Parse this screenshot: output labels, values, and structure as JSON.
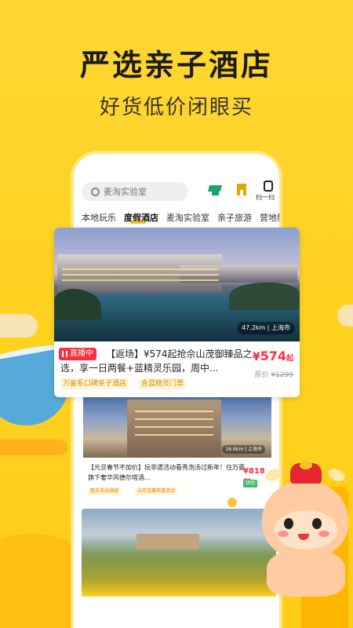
{
  "promo": {
    "headline": "严选亲子酒店",
    "subline": "好货低价闭眼买"
  },
  "app": {
    "search": {
      "placeholder": "麦淘实验室",
      "icon": "search-icon"
    },
    "top_icons": [
      {
        "icon": "graduation-cap-icon",
        "color": "#1DA36B"
      },
      {
        "icon": "building-icon",
        "color": "#E0A800"
      },
      {
        "icon": "scan-icon",
        "label": "扫一扫"
      }
    ],
    "tabs": [
      {
        "label": "本地玩乐"
      },
      {
        "label": "度假酒店",
        "active": true
      },
      {
        "label": "麦淘实验室"
      },
      {
        "label": "亲子旅游"
      },
      {
        "label": "营地教"
      }
    ]
  },
  "featured_card": {
    "distance": "47.2km | 上海市",
    "live_badge": "直播中",
    "title": "【返场】¥574起抢佘山茂御臻品之选，享一日两餐+蓝精灵乐园，周中...",
    "price_prefix": "¥",
    "price": "574",
    "price_suffix": "起",
    "original_label": "原价",
    "original_price": "¥1299",
    "tags": [
      "万豪系口碑亲子酒店",
      "含蓝精灵门票"
    ]
  },
  "card2": {
    "distance": "16.6km | 上海市",
    "title": "【元旦春节不加价】玩非遗活动看秀泡汤过新年！住万豪旗下奢华风德尔塔酒...",
    "price": "¥818起",
    "badge": "拼团",
    "tags": [
      "整乐活动满级",
      "元旦宝藏非遗活动"
    ]
  },
  "colors": {
    "background": "#FFD21F",
    "accent_red": "#FF2D3E",
    "tag_text": "#D98A00",
    "tab_underline": "#FFC400"
  }
}
